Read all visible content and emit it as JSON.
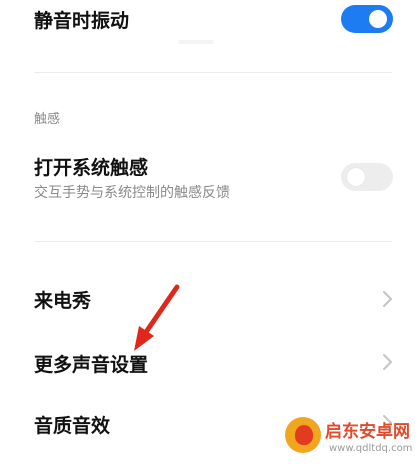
{
  "settings": {
    "vibrate_silent": {
      "label": "静音时振动",
      "enabled": true
    },
    "haptics_section": {
      "header": "触感"
    },
    "system_haptics": {
      "label": "打开系统触感",
      "description": "交互手势与系统控制的触感反馈",
      "enabled": false
    },
    "ringtone_show": {
      "label": "来电秀"
    },
    "more_sound": {
      "label": "更多声音设置"
    },
    "sound_quality": {
      "label": "音质音效"
    }
  },
  "watermark": {
    "brand": "启东安卓网",
    "url": "www.qdltdq.com"
  },
  "colors": {
    "toggle_on": "#1e7cf2",
    "toggle_off": "#ededed",
    "annotation_arrow": "#e0271c"
  }
}
